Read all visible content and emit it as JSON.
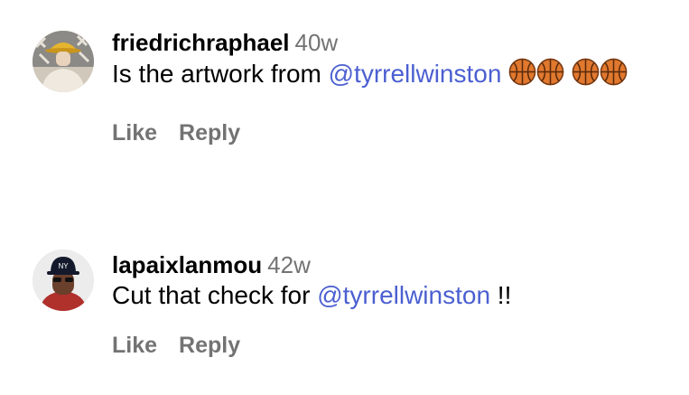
{
  "comments": [
    {
      "username": "friedrichraphael",
      "time": "40w",
      "text_before": "Is the artwork from ",
      "mention": "@tyrrellwinston",
      "text_after": "",
      "emojis": [
        "basketball-icon",
        "basketball-icon",
        "basketball-icon",
        "basketball-icon"
      ],
      "like_label": "Like",
      "reply_label": "Reply"
    },
    {
      "username": "lapaixlanmou",
      "time": "42w",
      "text_before": "Cut that check for ",
      "mention": "@tyrrellwinston",
      "text_after": " !!",
      "like_label": "Like",
      "reply_label": "Reply"
    }
  ],
  "colors": {
    "mention": "#4b5fd1",
    "meta": "#737373",
    "basketball": "#e0782e"
  }
}
